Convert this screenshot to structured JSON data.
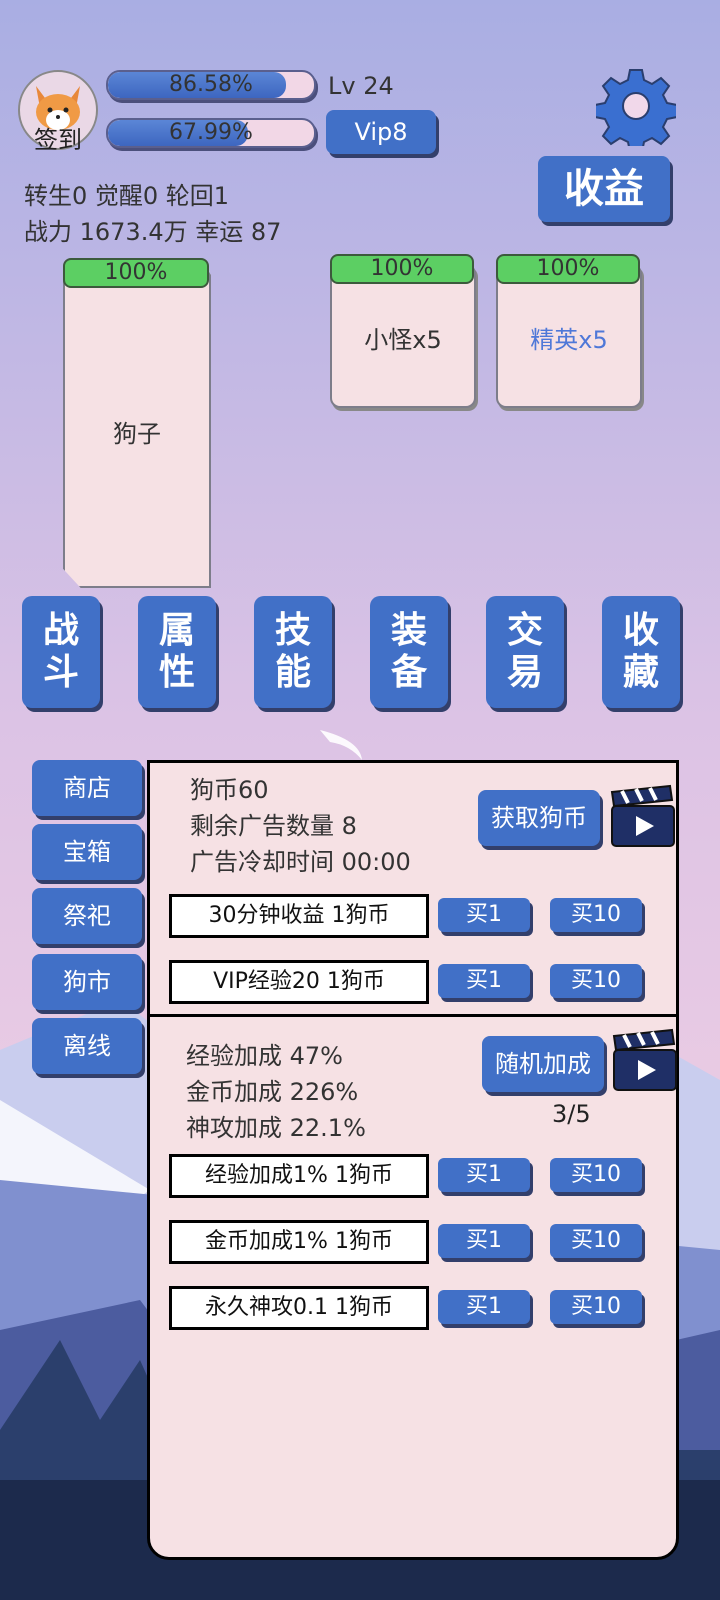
{
  "header": {
    "avatar_label": "签到",
    "bar1": {
      "text": "86.58%",
      "value": 0.8658
    },
    "bar2": {
      "text": "67.99%",
      "value": 0.6799
    },
    "level": "Lv 24",
    "vip": "Vip8",
    "earnings": "收益",
    "stats_line1": "转生0 觉醒0 轮回1",
    "stats_line2": "战力 1673.4万  幸运 87"
  },
  "battle": {
    "player": {
      "hp": "100%",
      "name": "狗子"
    },
    "enemies": [
      {
        "hp": "100%",
        "name": "小怪x5",
        "color": "#333333"
      },
      {
        "hp": "100%",
        "name": "精英x5",
        "color": "#4f78d8"
      }
    ]
  },
  "nav": [
    {
      "line1": "战",
      "line2": "斗"
    },
    {
      "line1": "属",
      "line2": "性"
    },
    {
      "line1": "技",
      "line2": "能"
    },
    {
      "line1": "装",
      "line2": "备"
    },
    {
      "line1": "交",
      "line2": "易"
    },
    {
      "line1": "收",
      "line2": "藏"
    }
  ],
  "sidebar": [
    "商店",
    "宝箱",
    "祭祀",
    "狗市",
    "离线"
  ],
  "market": {
    "coins": "狗币60",
    "ads_left": "剩余广告数量 8",
    "ad_cooldown": "广告冷却时间 00:00",
    "get_coins": "获取狗币",
    "items": [
      {
        "label": "30分钟收益 1狗币",
        "buy1": "买1",
        "buy10": "买10"
      },
      {
        "label": "VIP经验20 1狗币",
        "buy1": "买1",
        "buy10": "买10"
      }
    ]
  },
  "bonus": {
    "exp": "经验加成 47%",
    "gold": "金币加成 226%",
    "attack": "神攻加成 22.1%",
    "random_btn": "随机加成",
    "random_count": "3/5",
    "items": [
      {
        "label": "经验加成1% 1狗币",
        "buy1": "买1",
        "buy10": "买10"
      },
      {
        "label": "金币加成1% 1狗币",
        "buy1": "买1",
        "buy10": "买10"
      },
      {
        "label": "永久神攻0.1 1狗币",
        "buy1": "买1",
        "buy10": "买10"
      }
    ]
  },
  "colors": {
    "accent": "#4170c7",
    "panel": "#f6e1e4",
    "hp_green": "#5ccf63"
  }
}
